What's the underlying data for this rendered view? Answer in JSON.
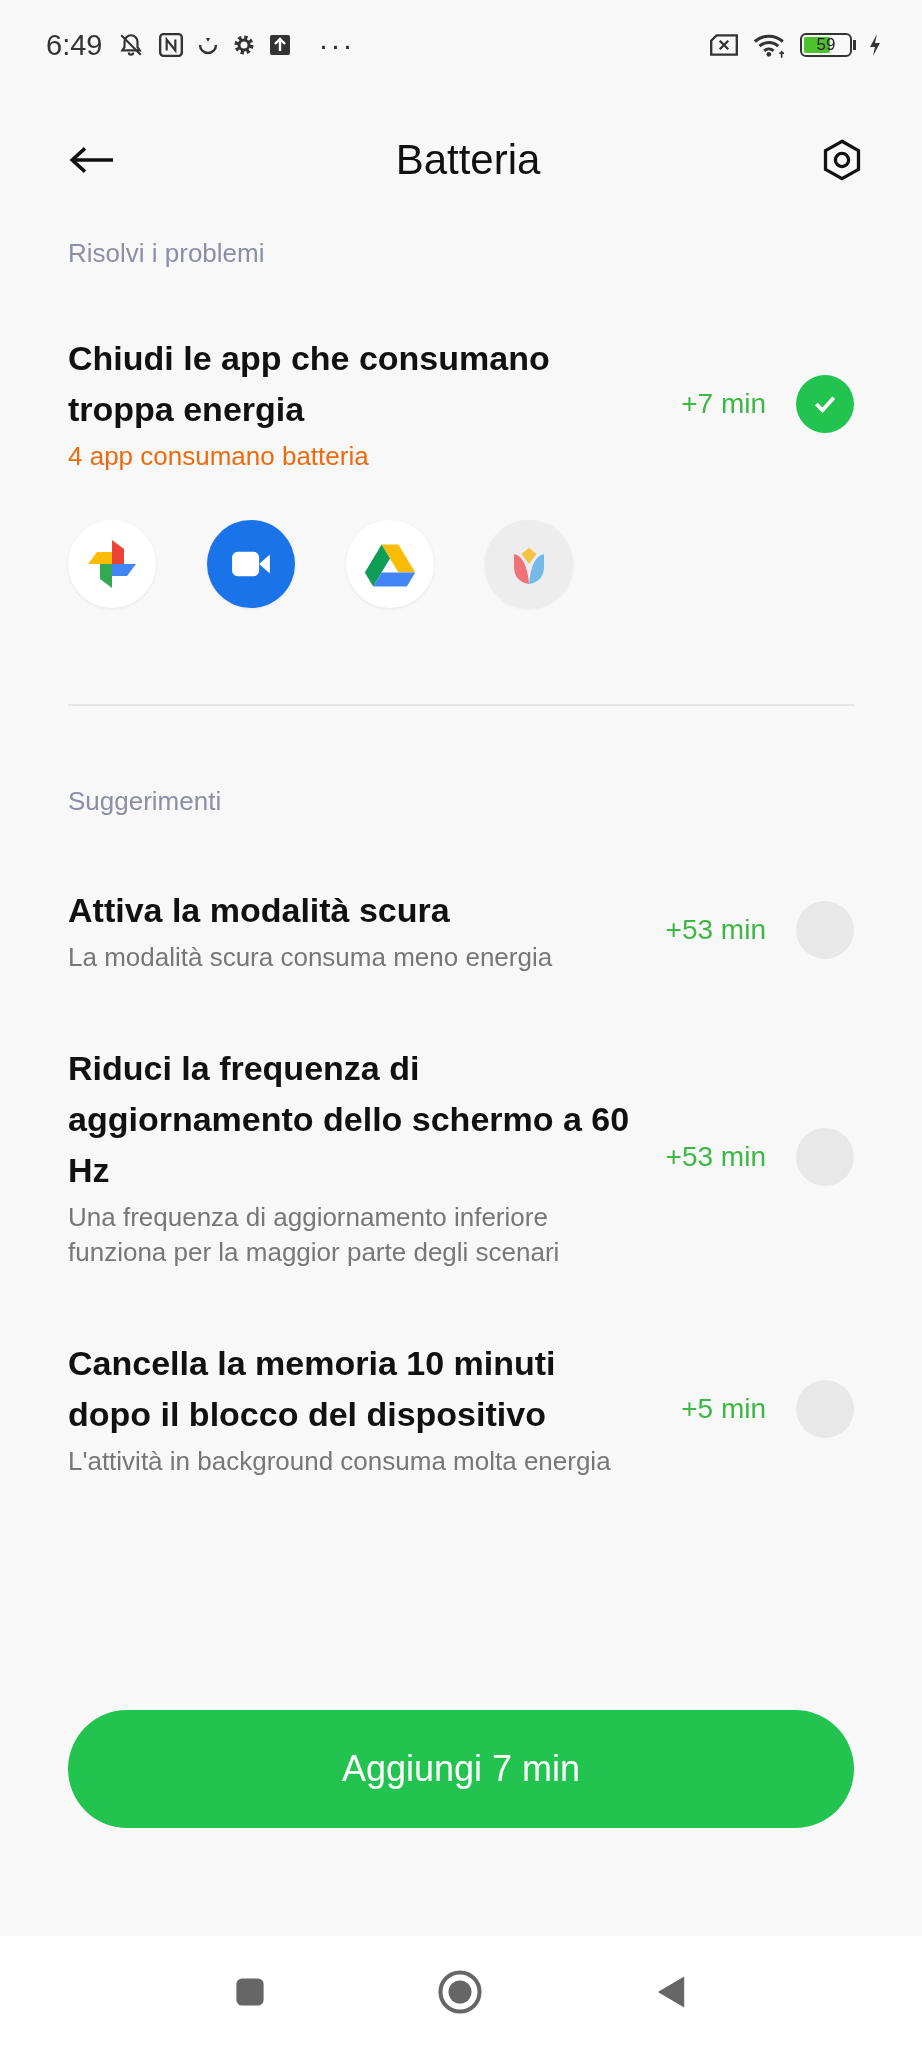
{
  "status_bar": {
    "time": "6:49",
    "more": "···",
    "battery": {
      "reading": "59",
      "level": 0.59,
      "charging": true
    }
  },
  "header": {
    "title": "Batteria"
  },
  "sections": [
    {
      "heading": "Risolvi i problemi",
      "items": [
        {
          "kind": "problem",
          "title": "Chiudi le app che consumano troppa energia",
          "subtitle": "4 app consumano batteria",
          "gain": "+7 min",
          "selected": true,
          "apps": [
            {
              "kind": "pinwheel"
            },
            {
              "kind": "video"
            },
            {
              "kind": "triangle"
            },
            {
              "kind": "tulip"
            }
          ]
        }
      ]
    },
    {
      "heading": "Suggerimenti",
      "items": [
        {
          "kind": "suggestion",
          "title": "Attiva la modalità scura",
          "subtitle": "La modalità scura consuma meno energia",
          "gain": "+53 min",
          "selected": false
        },
        {
          "kind": "suggestion",
          "title": "Riduci la frequenza di aggiornamento dello schermo a 60 Hz",
          "subtitle": "Una frequenza di aggiornamento inferiore funziona per la maggior parte degli scenari",
          "gain": "+53 min",
          "selected": false
        },
        {
          "kind": "suggestion",
          "title": "Cancella la memoria 10 minuti dopo il blocco del dispositivo",
          "subtitle": "L'attività in background consuma molta energia",
          "gain": "+5 min",
          "selected": false
        }
      ]
    }
  ],
  "action_button": "Aggiungi 7 min"
}
